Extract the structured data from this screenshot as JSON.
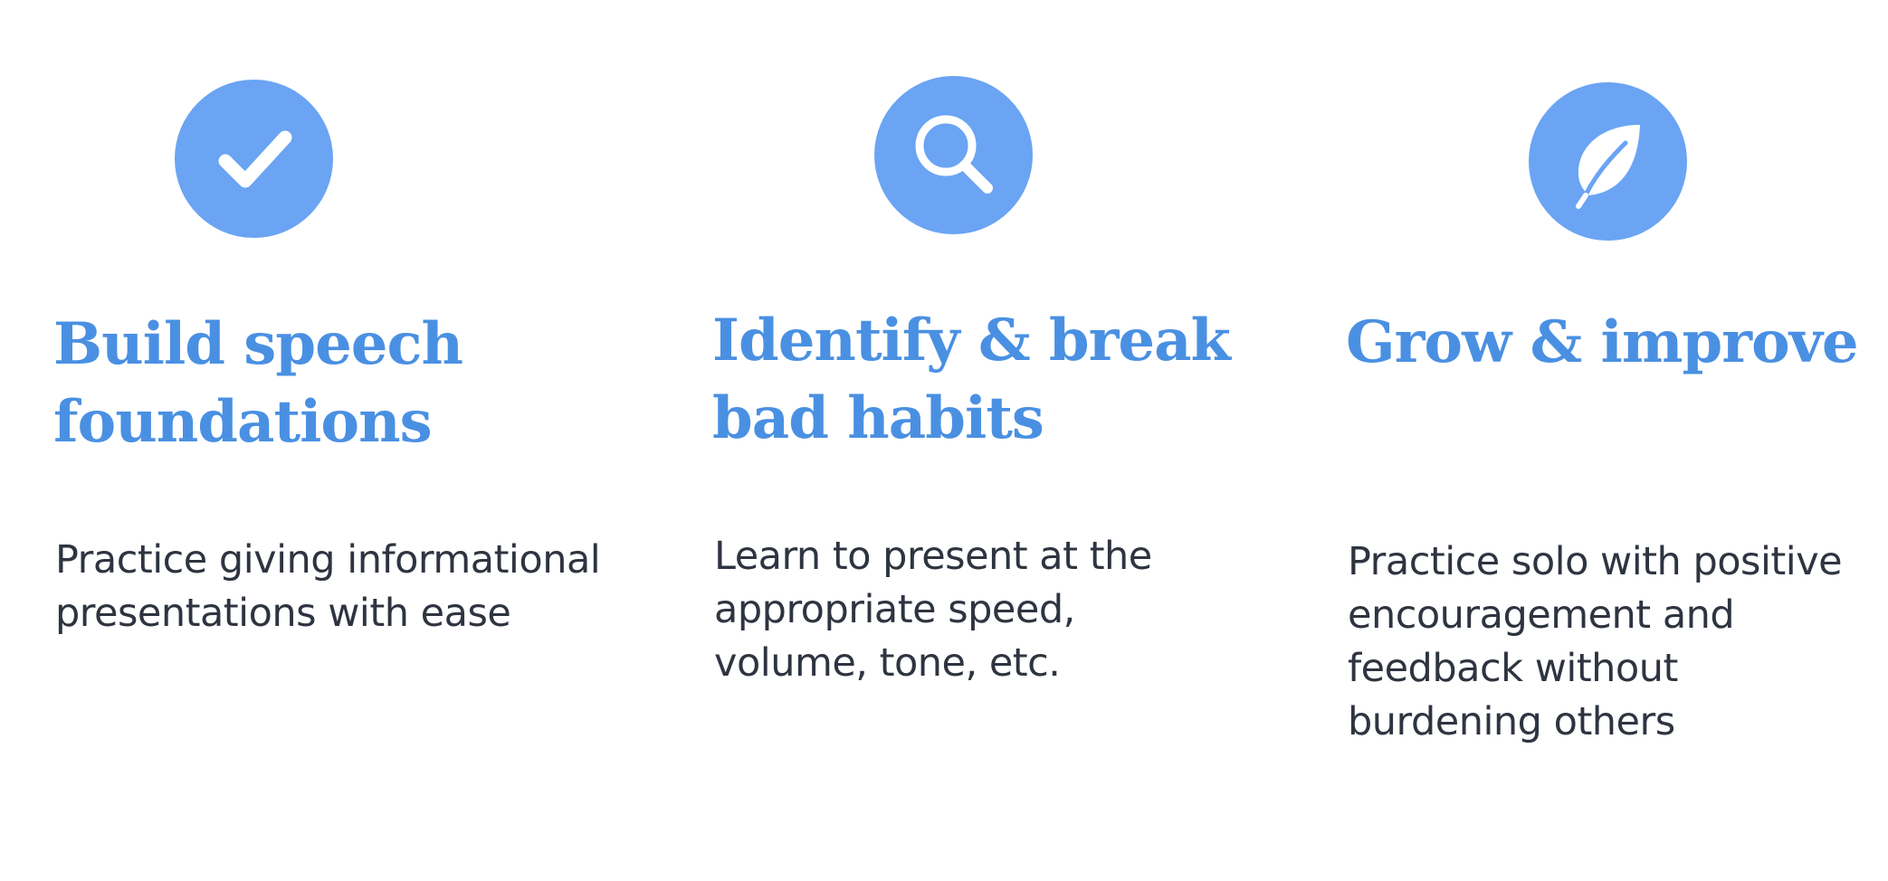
{
  "colors": {
    "accent": "#4A90E2",
    "icon_background": "#6AA4F3",
    "icon_glyph": "#ffffff",
    "body_text": "#2E3440",
    "background": "#ffffff"
  },
  "features": [
    {
      "icon": "checkmark-icon",
      "title": "Build speech foundations",
      "description": "Practice giving informational presentations with ease"
    },
    {
      "icon": "magnifying-glass-icon",
      "title": "Identify & break bad habits",
      "description": "Learn to present at the appropriate speed, volume, tone, etc."
    },
    {
      "icon": "leaf-icon",
      "title": "Grow & improve",
      "description": "Practice solo with positive encouragement and feedback without burdening others"
    }
  ],
  "title_lines": {
    "f0": [
      "Build speech",
      "foundations"
    ],
    "f1": [
      "Identify & break",
      "bad habits"
    ],
    "f2": [
      "Grow & improve"
    ]
  }
}
